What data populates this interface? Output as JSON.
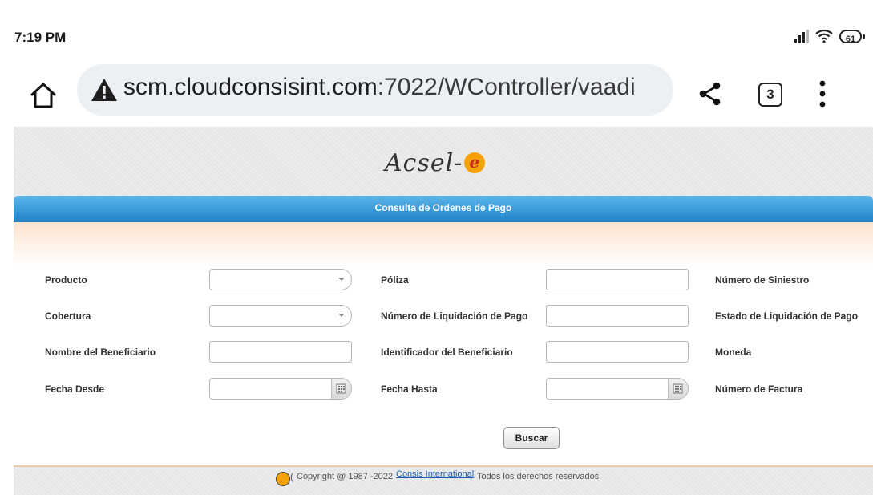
{
  "status_bar": {
    "time": "7:19 PM",
    "battery": "61"
  },
  "browser": {
    "url_host": "scm.cloudconsisint.com",
    "url_rest": ":7022/WController/vaadi",
    "tab_count": "3"
  },
  "app": {
    "logo_text": "Acsel-",
    "logo_e": "e",
    "page_title": "Consulta de Ordenes de Pago"
  },
  "form": {
    "producto": "Producto",
    "poliza": "Póliza",
    "numero_siniestro": "Número de Siniestro",
    "cobertura": "Cobertura",
    "numero_liquidacion": "Número de Liquidación de Pago",
    "estado_liquidacion": "Estado de Liquidación de Pago",
    "nombre_beneficiario": "Nombre del Beneficiario",
    "identificador_beneficiario": "Identificador del Beneficiario",
    "moneda": "Moneda",
    "fecha_desde": "Fecha Desde",
    "fecha_hasta": "Fecha Hasta",
    "numero_factura": "Número de Factura",
    "buscar": "Buscar"
  },
  "footer": {
    "copyright": "Copyright @ 1987 -2022",
    "company_link": "Consis International",
    "rights": "Todos los derechos reservados"
  },
  "icons": [
    "home-icon",
    "warning-icon",
    "share-icon",
    "more-vert-icon",
    "signal-icon",
    "wifi-icon",
    "battery-icon",
    "calendar-icon",
    "dropdown-arrow-icon",
    "consis-logo-icon"
  ]
}
